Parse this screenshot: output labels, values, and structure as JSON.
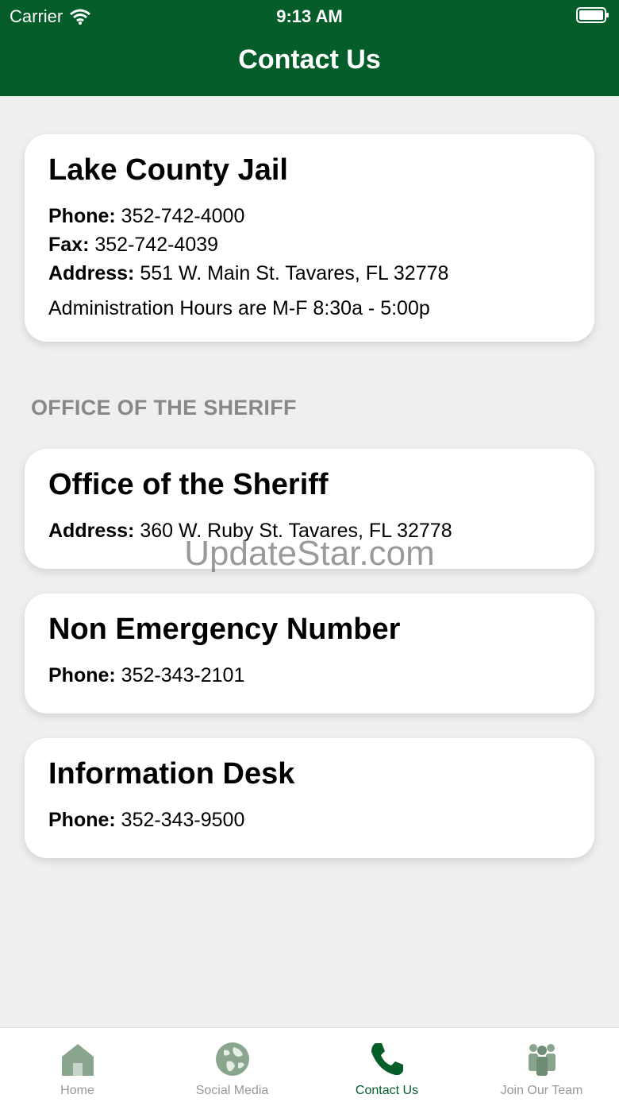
{
  "status_bar": {
    "carrier": "Carrier",
    "time": "9:13 AM"
  },
  "nav": {
    "title": "Contact Us"
  },
  "jail": {
    "title": "Lake County Jail",
    "phone_label": "Phone:",
    "phone": "352-742-4000",
    "fax_label": "Fax:",
    "fax": "352-742-4039",
    "address_label": "Address:",
    "address": "551 W. Main St.  Tavares, FL 32778",
    "hours": "Administration Hours are M-F 8:30a - 5:00p"
  },
  "section": {
    "title": "OFFICE OF THE SHERIFF"
  },
  "sheriff": {
    "title": "Office of the Sheriff",
    "address_label": "Address:",
    "address": "360 W. Ruby St. Tavares, FL 32778"
  },
  "non_emergency": {
    "title": "Non Emergency Number",
    "phone_label": "Phone:",
    "phone": "352-343-2101"
  },
  "info_desk": {
    "title": "Information Desk",
    "phone_label": "Phone:",
    "phone": "352-343-9500"
  },
  "watermark": "UpdateStar.com",
  "tabs": [
    {
      "label": "Home",
      "icon": "home-icon"
    },
    {
      "label": "Social Media",
      "icon": "globe-icon"
    },
    {
      "label": "Contact Us",
      "icon": "phone-icon"
    },
    {
      "label": "Join Our Team",
      "icon": "people-icon"
    }
  ],
  "colors": {
    "brand": "#055e2a",
    "background": "#efefef",
    "tab_inactive": "#999999"
  }
}
